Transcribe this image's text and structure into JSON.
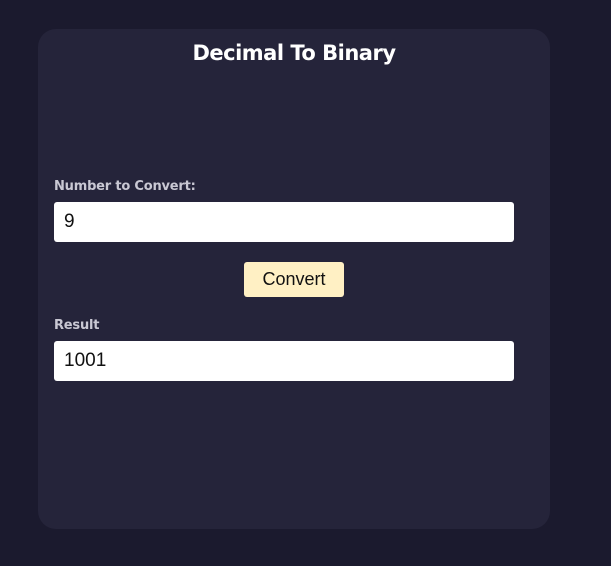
{
  "app": {
    "title": "Decimal To Binary"
  },
  "form": {
    "number_label": "Number to Convert:",
    "number_value": "9",
    "convert_label": "Convert",
    "result_label": "Result",
    "result_value": "1001"
  },
  "colors": {
    "page_background": "#1b1a2e",
    "card_background": "#25243a",
    "button_background": "#fff0c4"
  }
}
